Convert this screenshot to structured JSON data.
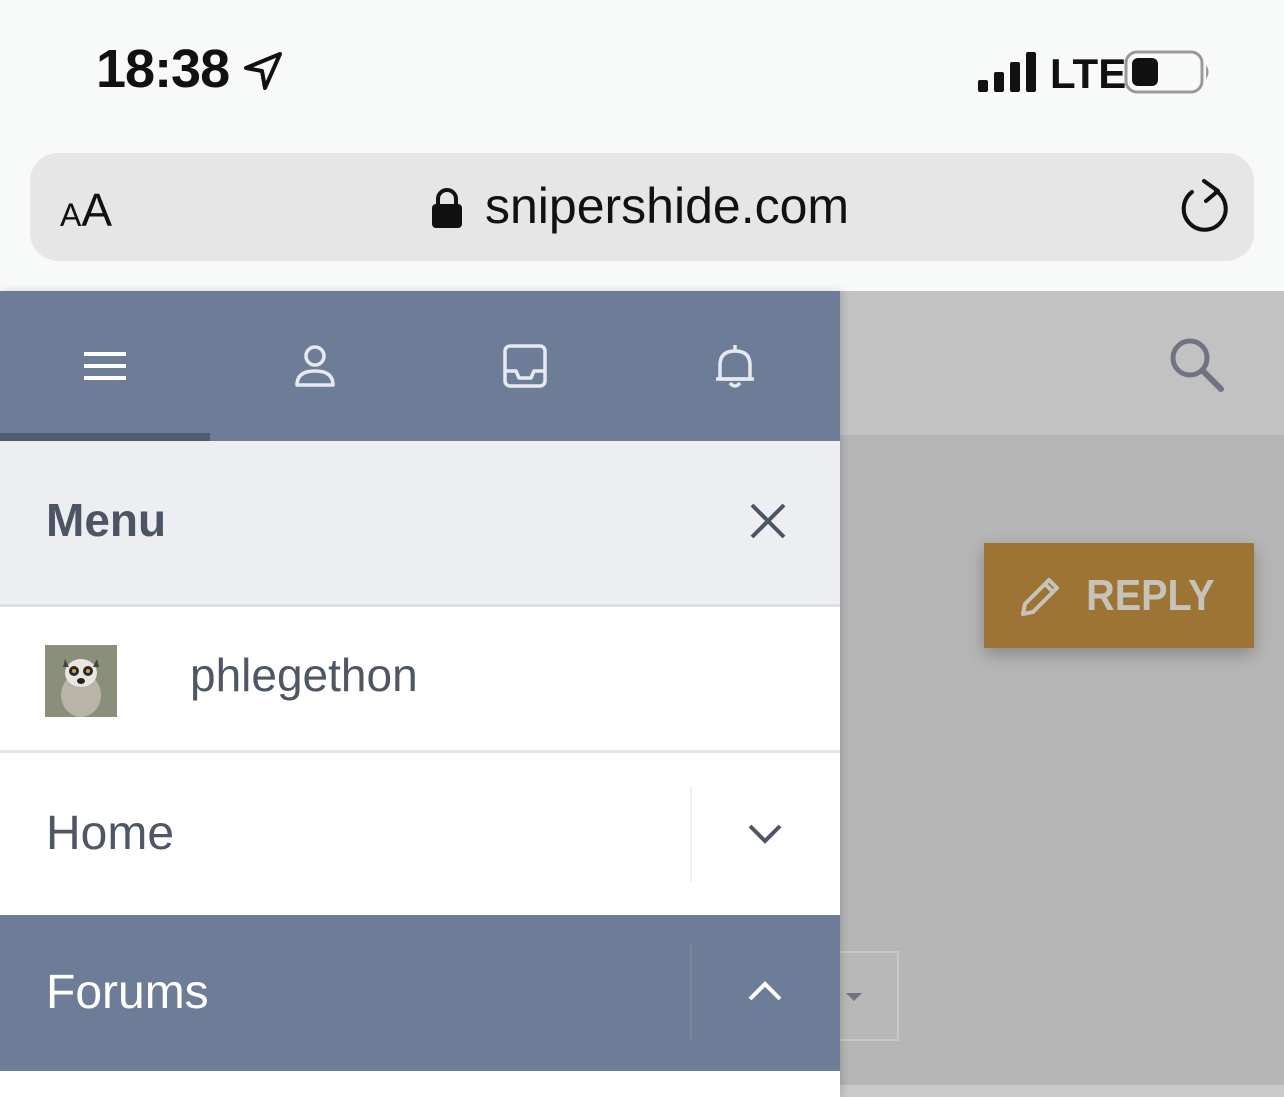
{
  "status_bar": {
    "time": "18:38",
    "network": "LTE"
  },
  "browser": {
    "text_size_small": "A",
    "text_size_large": "A",
    "url": "snipershide.com"
  },
  "page": {
    "reply_label": "REPLY"
  },
  "menu": {
    "tabs": [
      "menu-tab",
      "account-tab",
      "inbox-tab",
      "alerts-tab"
    ],
    "active_tab": 0,
    "title": "Menu",
    "username": "phlegethon",
    "items": [
      {
        "label": "Home",
        "expanded": false
      },
      {
        "label": "Forums",
        "expanded": true
      }
    ]
  },
  "colors": {
    "menu_accent": "#6d7d98",
    "reply_button": "#9e7434",
    "menu_text": "#4f5666"
  }
}
